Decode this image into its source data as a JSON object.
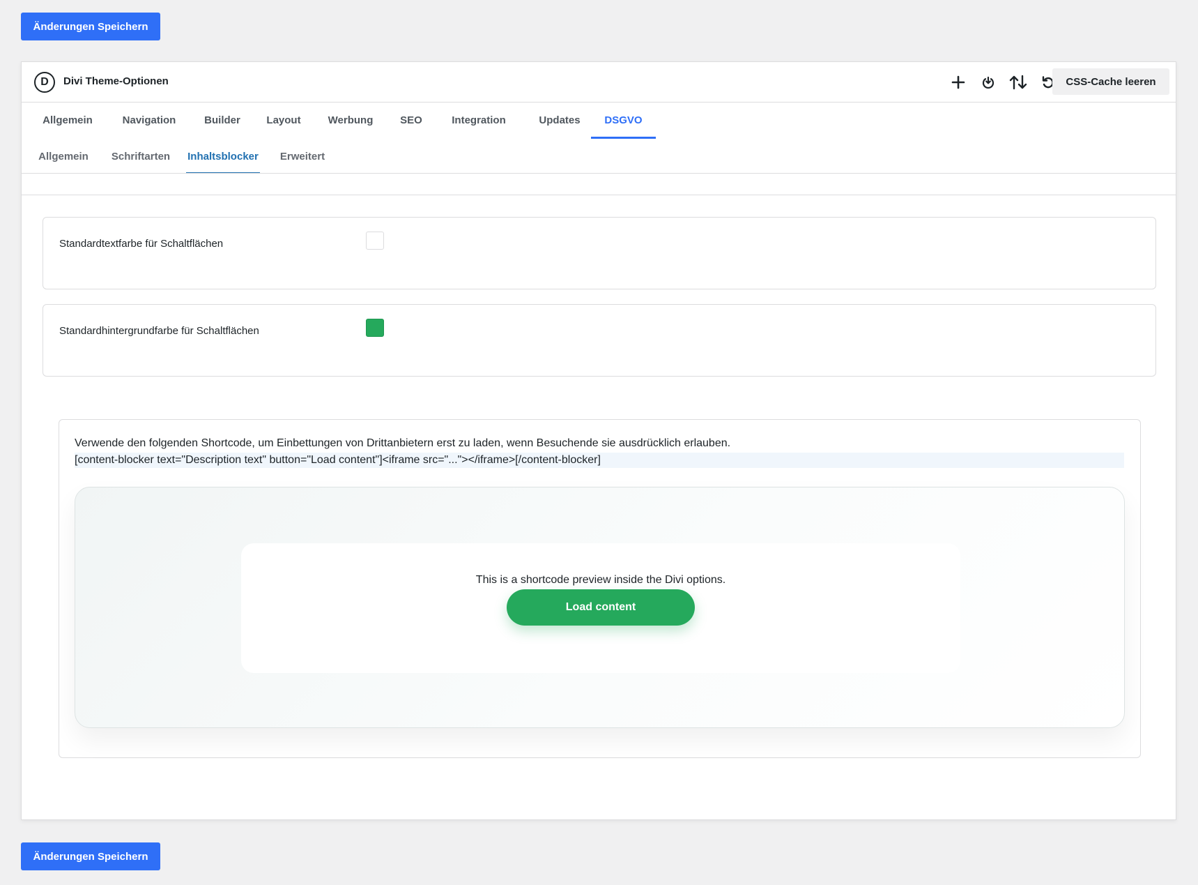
{
  "save_button_label": "Änderungen Speichern",
  "header": {
    "logo_letter": "D",
    "title": "Divi Theme-Optionen",
    "css_cache_button": "CSS-Cache leeren",
    "icons": [
      "plus-icon",
      "power-icon",
      "import-export-icon",
      "undo-icon"
    ]
  },
  "main_tabs": [
    {
      "label": "Allgemein"
    },
    {
      "label": "Navigation"
    },
    {
      "label": "Builder"
    },
    {
      "label": "Layout"
    },
    {
      "label": "Werbung"
    },
    {
      "label": "SEO"
    },
    {
      "label": "Integration"
    },
    {
      "label": "Updates"
    },
    {
      "label": "DSGVO",
      "active": true
    }
  ],
  "sub_tabs": [
    {
      "label": "Allgemein"
    },
    {
      "label": "Schriftarten"
    },
    {
      "label": "Inhaltsblocker",
      "active": true
    },
    {
      "label": "Erweitert"
    }
  ],
  "options": [
    {
      "label": "Standardtextfarbe für Schaltflächen",
      "color": "#ffffff"
    },
    {
      "label": "Standardhintergrundfarbe für Schaltflächen",
      "color": "#25a95c"
    }
  ],
  "shortcode": {
    "description": "Verwende den folgenden Shortcode, um Einbettungen von Drittanbietern erst zu laden, wenn Besuchende sie ausdrücklich erlauben.",
    "code": "[content-blocker text=\"Description text\" button=\"Load content\"]<iframe src=\"...\"></iframe>[/content-blocker]",
    "preview_text": "This is a shortcode preview inside the Divi options.",
    "preview_button": "Load content"
  },
  "colors": {
    "accent": "#2f6ff7",
    "success": "#25a95c"
  }
}
